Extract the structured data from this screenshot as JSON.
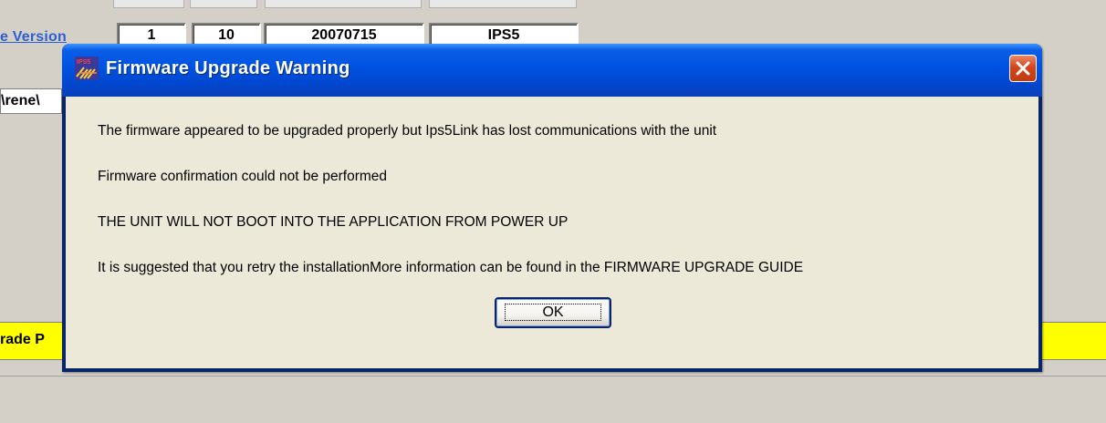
{
  "background": {
    "version_label": "e Version",
    "version_fields": [
      "1",
      "10",
      "20070715",
      "IPS5"
    ],
    "path_field": "\\rene\\",
    "progress_label": "rade P"
  },
  "dialog": {
    "title": "Firmware Upgrade Warning",
    "title_icon": "ips5-app-icon",
    "close_icon": "close-icon",
    "messages": [
      "The firmware appeared to be upgraded properly but Ips5Link has lost communications with the unit",
      "Firmware confirmation could not be performed",
      "THE UNIT WILL NOT BOOT INTO THE APPLICATION FROM POWER UP",
      "It is suggested that you retry the installationMore information can be found in the FIRMWARE UPGRADE GUIDE"
    ],
    "ok_label": "OK"
  },
  "colors": {
    "titlebar": "#0054e3",
    "client": "#ece9d8",
    "close_button": "#d5451c",
    "status_bar": "#ffff00",
    "link_blue": "#2c5fd6"
  }
}
